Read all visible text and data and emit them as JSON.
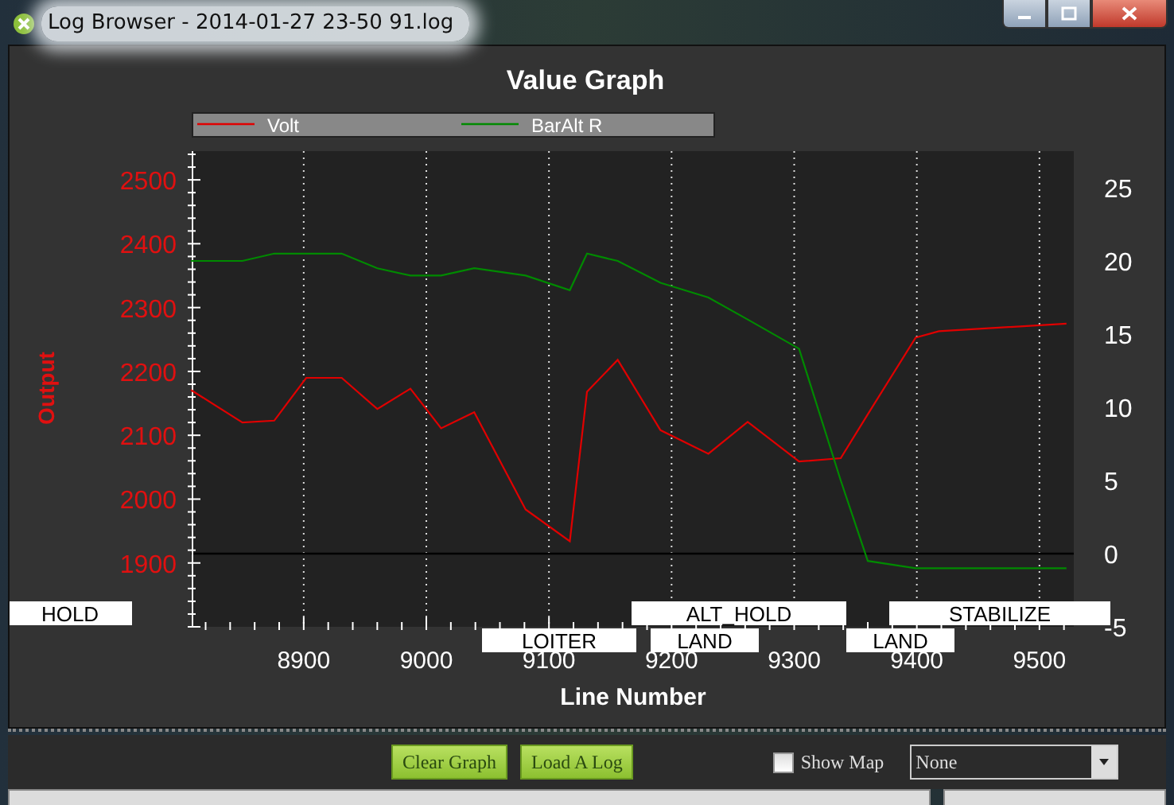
{
  "window": {
    "title": "Log Browser - 2014-01-27 23-50 91.log"
  },
  "graph": {
    "chart_data": {
      "type": "line",
      "title": "Value Graph",
      "xlabel": "Line Number",
      "ylabel": "Output",
      "x": [
        8808,
        8850,
        8876,
        8902,
        8931,
        8960,
        8987,
        9012,
        9039,
        9081,
        9117,
        9131,
        9156,
        9191,
        9230,
        9262,
        9304,
        9338,
        9360,
        9399,
        9418,
        9522
      ],
      "series": [
        {
          "name": "Volt",
          "color": "#e00000",
          "values": [
            2171,
            2120,
            2123,
            2190,
            2190,
            2141,
            2173,
            2111,
            2136,
            1984,
            1934,
            2168,
            2218,
            2108,
            2071,
            2121,
            2059,
            2064,
            2133,
            2253,
            2263,
            2275
          ]
        },
        {
          "name": "BarAlt R",
          "color": "#008a00",
          "axis": "y2",
          "values": [
            20,
            20,
            20.5,
            20.5,
            20.5,
            19.5,
            19,
            19,
            19.5,
            19,
            18,
            20.5,
            20,
            18.5,
            17.5,
            16,
            14,
            5,
            -0.5,
            -1,
            -1,
            -1
          ]
        }
      ],
      "xlim": [
        8808,
        9528
      ],
      "ylim": [
        1800,
        2545
      ],
      "xticks": [
        8900,
        9000,
        9100,
        9200,
        9300,
        9400,
        9500
      ],
      "yticks": [
        1900,
        2000,
        2100,
        2200,
        2300,
        2400,
        2500
      ],
      "y2lim": [
        -5,
        27.5
      ],
      "y2ticks": [
        -5,
        0,
        5,
        10,
        15,
        20,
        25
      ],
      "grid": true,
      "legend": "top"
    },
    "mode_labels": [
      {
        "text": "HOLD"
      },
      {
        "text": "LOITER"
      },
      {
        "text": "ALT_HOLD"
      },
      {
        "text": "LAND"
      },
      {
        "text": "LAND"
      },
      {
        "text": "STABILIZE"
      }
    ]
  },
  "controls": {
    "buttons": [
      "Clear Graph",
      "Load A Log"
    ],
    "show_map": {
      "label": "Show Map",
      "checked": false
    },
    "dropdown": {
      "value": "None"
    }
  }
}
